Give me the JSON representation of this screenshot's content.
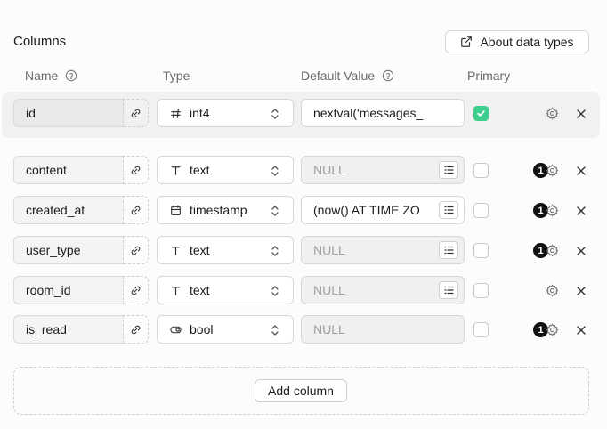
{
  "section": {
    "title": "Columns",
    "about_label": "About data types"
  },
  "headers": {
    "name": "Name",
    "type": "Type",
    "default_value": "Default Value",
    "primary": "Primary"
  },
  "columns": [
    {
      "name": "id",
      "type": "int4",
      "type_icon": "hash-icon",
      "default": "nextval('messages_",
      "default_is_null": false,
      "has_list": false,
      "primary": true,
      "badge": ""
    },
    {
      "name": "content",
      "type": "text",
      "type_icon": "text-type-icon",
      "default": "NULL",
      "default_is_null": true,
      "has_list": true,
      "primary": false,
      "badge": "1"
    },
    {
      "name": "created_at",
      "type": "timestamp",
      "type_icon": "calendar-icon",
      "default": "(now() AT TIME ZO",
      "default_is_null": false,
      "has_list": true,
      "primary": false,
      "badge": "1"
    },
    {
      "name": "user_type",
      "type": "text",
      "type_icon": "text-type-icon",
      "default": "NULL",
      "default_is_null": true,
      "has_list": true,
      "primary": false,
      "badge": "1"
    },
    {
      "name": "room_id",
      "type": "text",
      "type_icon": "text-type-icon",
      "default": "NULL",
      "default_is_null": true,
      "has_list": true,
      "primary": false,
      "badge": ""
    },
    {
      "name": "is_read",
      "type": "bool",
      "type_icon": "toggle-icon",
      "default": "NULL",
      "default_is_null": true,
      "has_list": false,
      "primary": false,
      "badge": "1"
    }
  ],
  "add_column_label": "Add column",
  "colors": {
    "accent": "#3ecf8e",
    "badge": "#111111"
  }
}
